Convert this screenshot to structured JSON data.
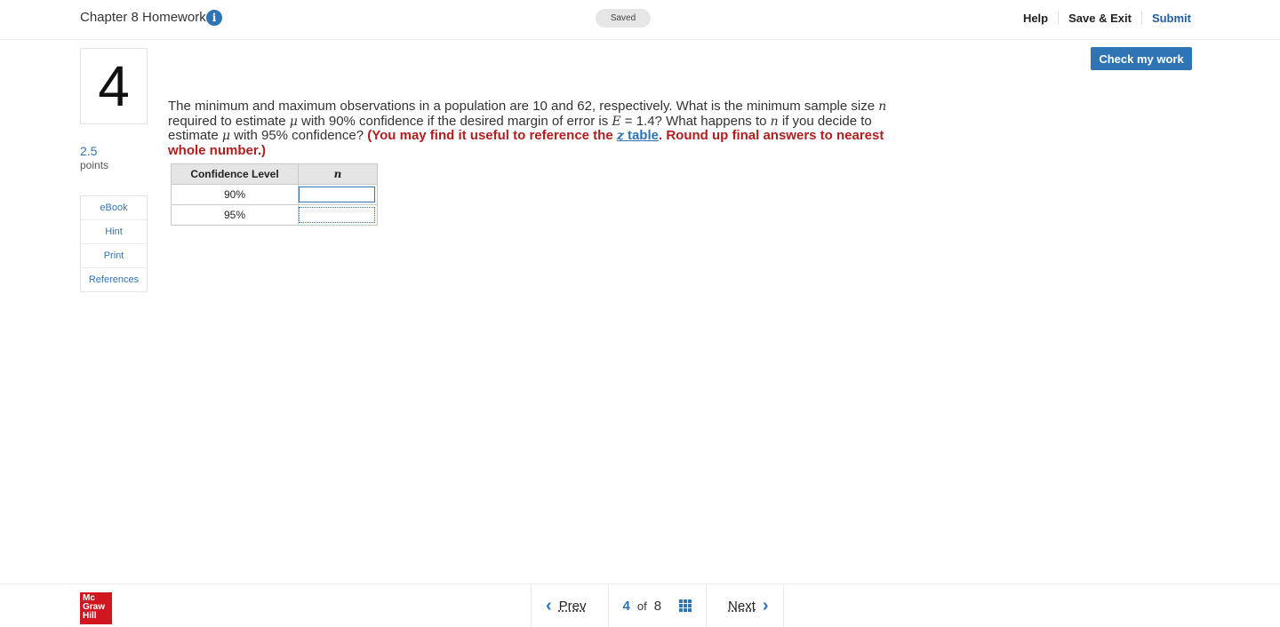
{
  "header": {
    "title": "Chapter 8 Homework",
    "info_icon": "i",
    "saved_label": "Saved",
    "links": [
      "Help",
      "Save & Exit",
      "Submit"
    ],
    "check_button": "Check my work"
  },
  "question_panel": {
    "number": "4",
    "points_value": "2.5",
    "points_label": "points",
    "menu": [
      "eBook",
      "Hint",
      "Print",
      "References"
    ]
  },
  "question": {
    "text_part1": "The minimum and maximum observations in a population are 10 and 62, respectively. What is the minimum sample size ",
    "var_n": "n",
    "text_part2": " required to estimate ",
    "var_mu": "μ",
    "text_part3": " with 90% confidence if the desired margin of error is ",
    "var_E": "E",
    "text_part4": " = 1.4? What happens to ",
    "text_part5": " if you decide to estimate ",
    "text_part6": " with 95% confidence? ",
    "instr_part1": "(You may find it useful to reference the ",
    "z_link_var": "z",
    "z_link_text": " table",
    "instr_part2": ". Round up final answers to nearest whole number.)"
  },
  "table": {
    "headers": [
      "Confidence Level",
      "n"
    ],
    "rows": [
      {
        "level": "90%",
        "n": ""
      },
      {
        "level": "95%",
        "n": ""
      }
    ]
  },
  "footer": {
    "logo_lines": [
      "Mc",
      "Graw",
      "Hill"
    ],
    "prev": "Prev",
    "next": "Next",
    "current": "4",
    "of": "of",
    "total": "8"
  },
  "colors": {
    "accent": "#2f74b5",
    "instruction_red": "#b01e1e",
    "logo_red": "#d0161f"
  }
}
